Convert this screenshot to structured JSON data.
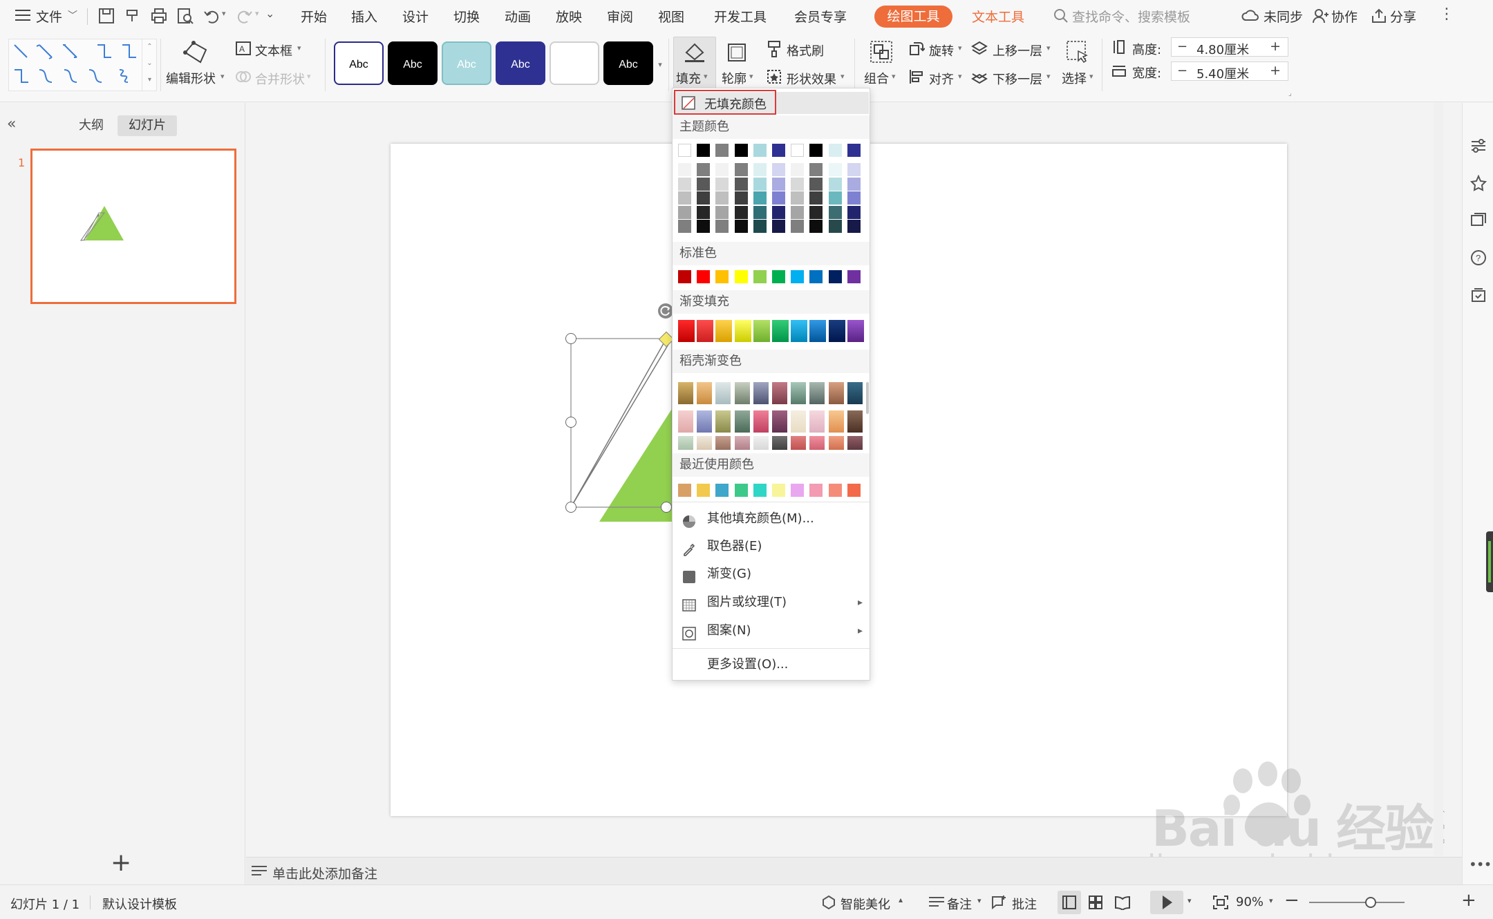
{
  "menubar": {
    "file_label": "文件",
    "tabs": [
      "开始",
      "插入",
      "设计",
      "切换",
      "动画",
      "放映",
      "审阅",
      "视图",
      "开发工具",
      "会员专享"
    ],
    "draw_tools_tab": "绘图工具",
    "text_tools_tab": "文本工具",
    "search_placeholder": "查找命令、搜索模板",
    "sync_label": "未同步",
    "collab_label": "协作",
    "share_label": "分享"
  },
  "ribbon": {
    "edit_shape_label": "编辑形状",
    "textbox_label": "文本框",
    "merge_shape_label": "合并形状",
    "style_presets": [
      {
        "text": "Abc",
        "bg": "#ffffff",
        "fg": "#000000",
        "border": "#2a2a8a"
      },
      {
        "text": "Abc",
        "bg": "#000000",
        "fg": "#ffffff",
        "border": "#000000"
      },
      {
        "text": "Abc",
        "bg": "#a9d9de",
        "fg": "#ffffff",
        "border": "#7fbfc5"
      },
      {
        "text": "Abc",
        "bg": "#2e3192",
        "fg": "#ffffff",
        "border": "#2e3192"
      },
      {
        "text": "",
        "bg": "#ffffff",
        "fg": "#000000",
        "border": "#cfcfcf"
      },
      {
        "text": "Abc",
        "bg": "#000000",
        "fg": "#ffffff",
        "border": "#000000"
      }
    ],
    "fill_label": "填充",
    "outline_label": "轮廓",
    "format_brush_label": "格式刷",
    "shape_effect_label": "形状效果",
    "group_label": "组合",
    "rotate_label": "旋转",
    "align_label": "对齐",
    "bring_forward_label": "上移一层",
    "send_backward_label": "下移一层",
    "select_label": "选择",
    "height_label": "高度:",
    "height_value": "4.80厘米",
    "width_label": "宽度:",
    "width_value": "5.40厘米"
  },
  "left_panel": {
    "outline_tab": "大纲",
    "slides_tab": "幻灯片",
    "slide_number": "1",
    "add_slide": "+"
  },
  "notes_placeholder": "单击此处添加备注",
  "status": {
    "slide_counter": "幻灯片 1 / 1",
    "template": "默认设计模板",
    "beautify": "智能美化",
    "notes": "备注",
    "comments": "批注",
    "zoom": "90%"
  },
  "fill_menu": {
    "no_fill": "无填充颜色",
    "theme_colors_label": "主题颜色",
    "theme_top_row": [
      "#ffffff",
      "#000000",
      "#808080",
      "#000000",
      "#a9d9de",
      "#2e3192",
      "#ffffff",
      "#000000",
      "#d9eef0",
      "#2e3192"
    ],
    "theme_shade_rows": [
      [
        "#f2f2f2",
        "#7f7f7f",
        "#f2f2f2",
        "#7f7f7f",
        "#dcf0f2",
        "#d4d5f0",
        "#f2f2f2",
        "#7f7f7f",
        "#eaf6f7",
        "#d4d5f0"
      ],
      [
        "#d9d9d9",
        "#595959",
        "#d9d9d9",
        "#595959",
        "#a9d9de",
        "#a9abe1",
        "#d9d9d9",
        "#595959",
        "#b5dde1",
        "#a9abe1"
      ],
      [
        "#bfbfbf",
        "#3f3f3f",
        "#bfbfbf",
        "#3f3f3f",
        "#4aa5ae",
        "#7e81d2",
        "#bfbfbf",
        "#3f3f3f",
        "#6cb8bf",
        "#7e81d2"
      ],
      [
        "#a5a5a5",
        "#262626",
        "#a5a5a5",
        "#262626",
        "#2e6e74",
        "#22256e",
        "#a5a5a5",
        "#262626",
        "#3b6d72",
        "#22256e"
      ],
      [
        "#7f7f7f",
        "#0d0d0d",
        "#7f7f7f",
        "#0d0d0d",
        "#1e4a4e",
        "#171949",
        "#7f7f7f",
        "#0d0d0d",
        "#27494c",
        "#171949"
      ]
    ],
    "standard_colors_label": "标准色",
    "standard_colors": [
      "#c00000",
      "#ff0000",
      "#ffc000",
      "#ffff00",
      "#92d050",
      "#00b050",
      "#00b0f0",
      "#0070c0",
      "#002060",
      "#7030a0"
    ],
    "gradient_fill_label": "渐变填充",
    "gradient_fill": [
      [
        "#ff2a2a",
        "#c00000"
      ],
      [
        "#ff4d4d",
        "#cc1f1f"
      ],
      [
        "#ffd24d",
        "#d9a100"
      ],
      [
        "#ffff66",
        "#cccc00"
      ],
      [
        "#b3e066",
        "#6fb02e"
      ],
      [
        "#33cc77",
        "#00954a"
      ],
      [
        "#33c0f5",
        "#0085b8"
      ],
      [
        "#3399e6",
        "#005599"
      ],
      [
        "#1a3d80",
        "#00164d"
      ],
      [
        "#9955cc",
        "#5a2285"
      ]
    ],
    "docer_gradient_label": "稻壳渐变色",
    "docer_gradients": [
      [
        [
          "#d7b46a",
          "#8a6a2e"
        ],
        [
          "#f2c58a",
          "#c98b3e"
        ],
        [
          "#dfe8e8",
          "#a9bcbf"
        ],
        [
          "#c8d0c0",
          "#6f7d6b"
        ],
        [
          "#a0a6c0",
          "#4d5271"
        ],
        [
          "#c27a86",
          "#7a3a47"
        ],
        [
          "#a8c8b8",
          "#567a6a"
        ],
        [
          "#a8b8b0",
          "#546460"
        ],
        [
          "#d8a080",
          "#8a5a40"
        ],
        [
          "#3a6c8a",
          "#173a50"
        ]
      ],
      [
        [
          "#f5d0d0",
          "#e0a8a8"
        ],
        [
          "#b0b8e0",
          "#7078b0"
        ],
        [
          "#c8c890",
          "#8a8a4a"
        ],
        [
          "#90a898",
          "#4a6a58"
        ],
        [
          "#f08098",
          "#c04060"
        ],
        [
          "#a06080",
          "#603050"
        ],
        [
          "#f5eee0",
          "#e8dcc4"
        ],
        [
          "#f5d8e0",
          "#e0b0c0"
        ],
        [
          "#f8c890",
          "#e09050"
        ],
        [
          "#8a6a58",
          "#4a3024"
        ]
      ],
      [
        [
          "#d0e0d0",
          "#a8c0a8"
        ],
        [
          "#f0e8dc",
          "#d8c8b0"
        ],
        [
          "#c8a090",
          "#987060"
        ],
        [
          "#d8b0b8",
          "#b08088"
        ],
        [
          "#f0f0f0",
          "#d8d8d8"
        ],
        [
          "#707070",
          "#404040"
        ],
        [
          "#e08080",
          "#c05050"
        ],
        [
          "#f090a0",
          "#d06070"
        ],
        [
          "#f0a080",
          "#d07050"
        ],
        [
          "#906068",
          "#603840"
        ]
      ]
    ],
    "recent_colors_label": "最近使用颜色",
    "recent_colors": [
      "#d9a066",
      "#f2c94c",
      "#3fa7c9",
      "#3dc98a",
      "#2fd6c6",
      "#f8f49a",
      "#e9a7f0",
      "#f39bb3",
      "#f58c7a",
      "#f36a4a"
    ],
    "more_fill_colors": "其他填充颜色(M)...",
    "eyedropper": "取色器(E)",
    "gradient": "渐变(G)",
    "picture_texture": "图片或纹理(T)",
    "pattern": "图案(N)",
    "more_settings": "更多设置(O)..."
  },
  "watermark": {
    "brand": "Bai du 经验",
    "url": "jingyan.baidu.com"
  },
  "colors": {
    "accent": "#ee6d3b",
    "triangle_fill": "#92d050",
    "selection_border": "#d93a3a"
  }
}
